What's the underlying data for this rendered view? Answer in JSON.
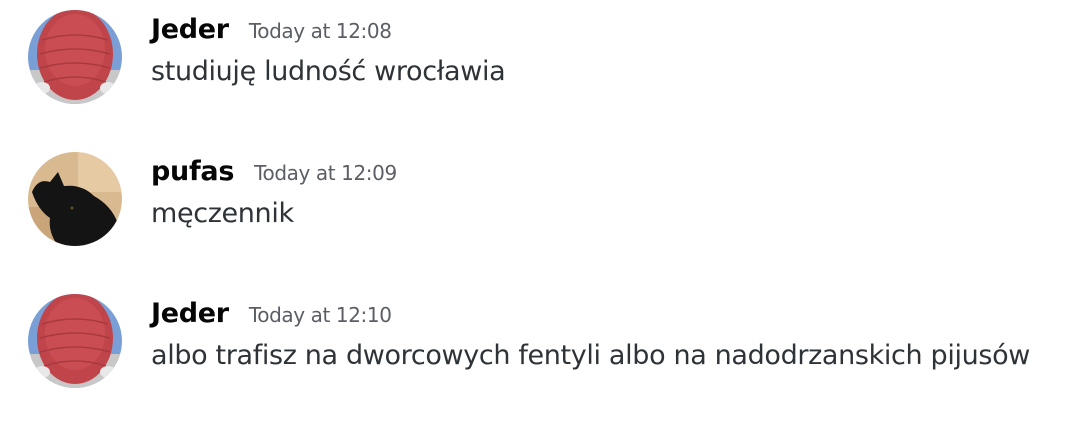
{
  "messages": [
    {
      "author": "Jeder",
      "timestamp": "Today at 12:08",
      "text": "studiuję ludność wrocławia",
      "avatar": "red-helmet-avatar"
    },
    {
      "author": "pufas",
      "timestamp": "Today at 12:09",
      "text": "męczennik",
      "avatar": "black-cat-avatar"
    },
    {
      "author": "Jeder",
      "timestamp": "Today at 12:10",
      "text": "albo trafisz na dworcowych fentyli albo na nadodrzanskich pijusów",
      "avatar": "red-helmet-avatar"
    }
  ],
  "colors": {
    "username": "#060607",
    "timestamp": "#5c5e66",
    "message_text": "#2e3338",
    "background": "#ffffff"
  }
}
